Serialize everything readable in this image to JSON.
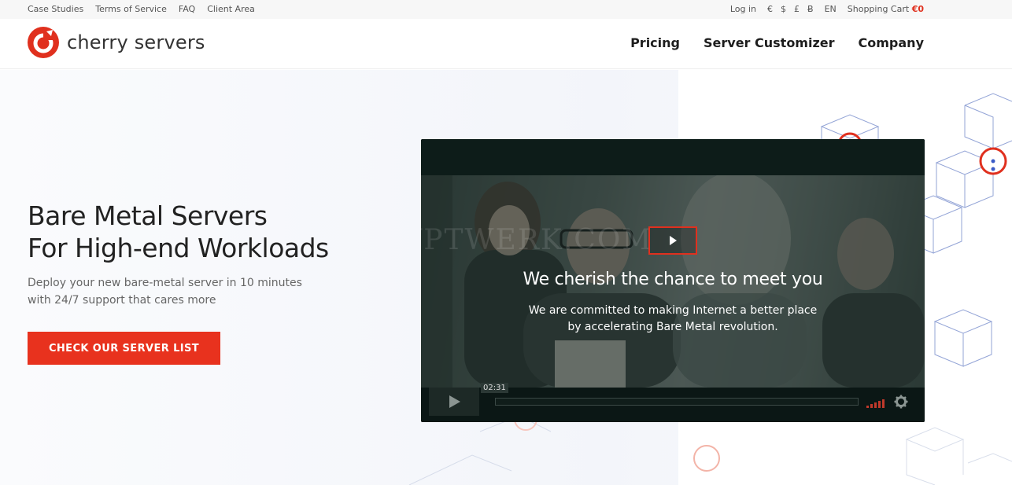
{
  "topbar": {
    "links": [
      "Case Studies",
      "Terms of Service",
      "FAQ",
      "Client Area"
    ],
    "login": "Log in",
    "currencies": [
      "€",
      "$",
      "£",
      "Ƀ"
    ],
    "language": "EN",
    "cart_label": "Shopping Cart",
    "cart_amount": "€0"
  },
  "header": {
    "brand": "cherry servers",
    "nav": [
      "Pricing",
      "Server Customizer",
      "Company"
    ]
  },
  "hero": {
    "title_line1": "Bare Metal Servers",
    "title_line2": "For High-end Workloads",
    "subtitle": "Deploy your new bare-metal server in 10 minutes with 24/7 support that cares more",
    "cta": "CHECK OUR SERVER LIST"
  },
  "video": {
    "headline": "We cherish the chance to meet you",
    "copy_line1": "We are committed to making Internet a better place",
    "copy_line2": "by accelerating Bare Metal revolution.",
    "timecode": "02:31",
    "watermark": "CRYPTWERK.COM"
  },
  "colors": {
    "brand_red": "#e0301e",
    "video_dark": "#0c1a17"
  }
}
